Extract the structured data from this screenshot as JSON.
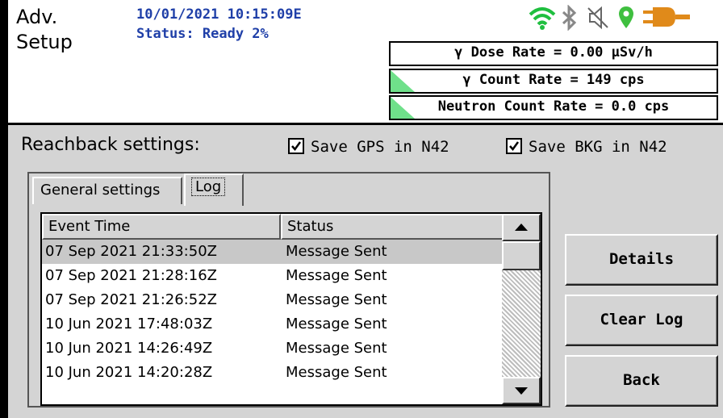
{
  "header": {
    "title_line1": "Adv.",
    "title_line2": "Setup",
    "datetime": "10/01/2021 10:15:09E",
    "status": "Status: Ready 2%",
    "icons": [
      "wifi-icon",
      "bluetooth-icon",
      "speaker-muted-icon",
      "location-pin-icon",
      "power-plug-icon"
    ],
    "rates": {
      "dose": "γ Dose Rate = 0.00  μSv/h",
      "count": "γ Count Rate = 149 cps",
      "neutron": "Neutron Count Rate = 0.0 cps"
    }
  },
  "reachback": {
    "label": "Reachback settings:",
    "save_gps": {
      "label": "Save GPS in N42",
      "checked": true
    },
    "save_bkg": {
      "label": "Save BKG in N42",
      "checked": true
    }
  },
  "tabs": [
    {
      "label": "General settings",
      "active": false
    },
    {
      "label": "Log",
      "active": true
    }
  ],
  "log": {
    "columns": [
      "Event Time",
      "Status"
    ],
    "rows": [
      {
        "time": "07 Sep 2021 21:33:50Z",
        "status": "Message Sent",
        "selected": true
      },
      {
        "time": "07 Sep 2021 21:28:16Z",
        "status": "Message Sent",
        "selected": false
      },
      {
        "time": "07 Sep 2021 21:26:52Z",
        "status": "Message Sent",
        "selected": false
      },
      {
        "time": "10 Jun 2021 17:48:03Z",
        "status": "Message Sent",
        "selected": false
      },
      {
        "time": "10 Jun 2021 14:26:49Z",
        "status": "Message Sent",
        "selected": false
      },
      {
        "time": "10 Jun 2021 14:20:28Z",
        "status": "Message Sent",
        "selected": false
      }
    ]
  },
  "buttons": {
    "details": "Details",
    "clear_log": "Clear Log",
    "back": "Back"
  },
  "colors": {
    "status_text": "#1f3fa8",
    "wifi": "#1fbf3f",
    "location": "#3fbf3f",
    "plug": "#e08a1a",
    "rate_indicator": "#6fe08a"
  }
}
